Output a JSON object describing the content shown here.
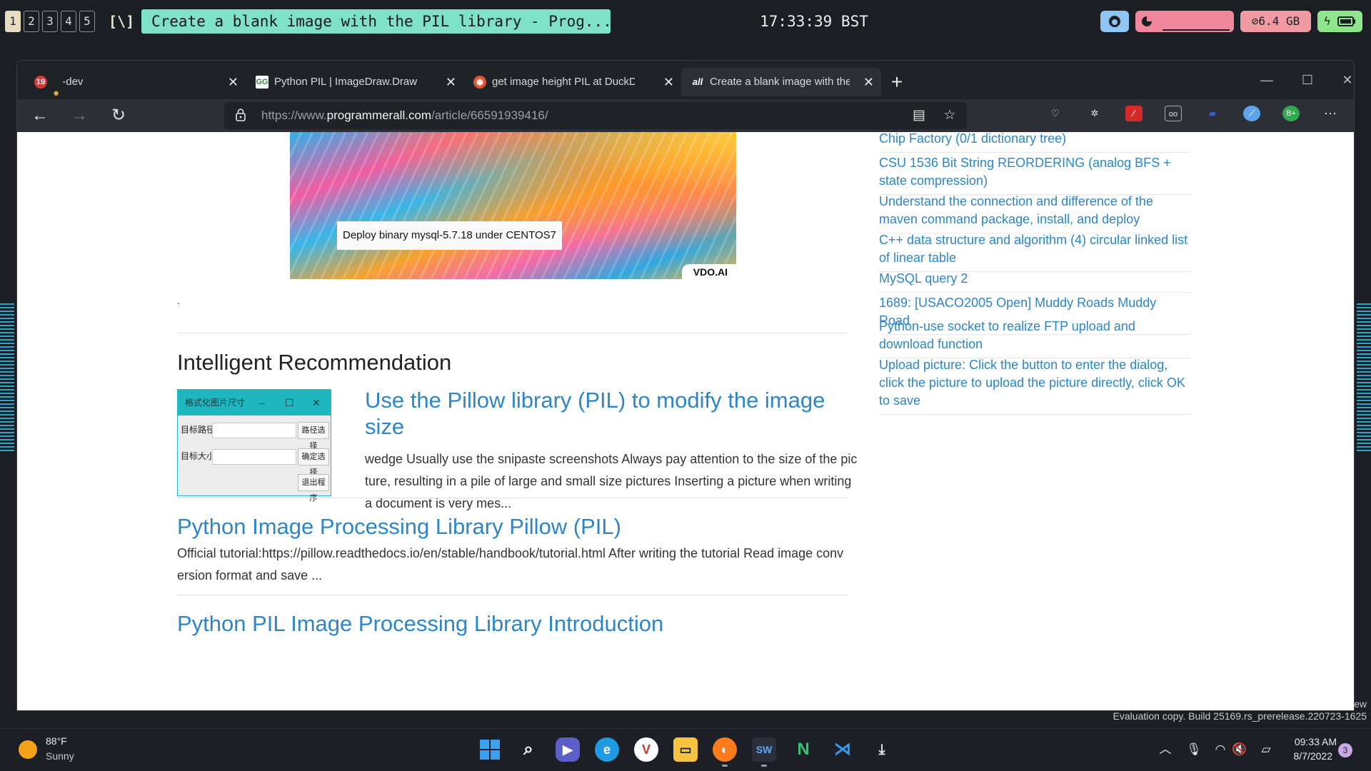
{
  "topbar": {
    "workspaces": [
      "1",
      "2",
      "3",
      "4",
      "5"
    ],
    "layout_symbol": "[\\]",
    "window_title": "Create a blank image with the PIL library - Prog...",
    "clock": "17:33:39 BST",
    "memory": "6.4 GB"
  },
  "browser": {
    "tabs": [
      {
        "label": "-dev",
        "badge": "19",
        "icon": "profile-icon"
      },
      {
        "label": "Python PIL | ImageDraw.Draw.pol",
        "icon": "gfg-icon"
      },
      {
        "label": "get image height PIL at DuckDuc",
        "icon": "duckduckgo-icon"
      },
      {
        "label": "Create a blank image with the PIL",
        "icon": "programmerall-icon",
        "active": true
      }
    ],
    "url_prefix": "https://www.",
    "url_host": "programmerall.com",
    "url_path": "/article/66591939416/"
  },
  "page": {
    "banner": {
      "caption": "Deploy binary mysql-5.7.18 under CENTOS7",
      "brand": "VDO.AI"
    },
    "stray_mark": ".",
    "section_title": "Intelligent Recommendation",
    "thumbnail": {
      "title": "格式化图片尺寸",
      "row1_label": "目标路径:",
      "row1_button": "路径选择",
      "row2_label": "目标大小:",
      "row2_button": "确定选择",
      "exit_button": "退出程序"
    },
    "recommendations": [
      {
        "title": "Use the Pillow library (PIL) to modify the image size",
        "desc": "wedge Usually use the snipaste screenshots Always pay attention to the size of the picture, resulting in a pile of large and small size pictures Inserting a picture when writing a document is very mes..."
      },
      {
        "title": "Python Image Processing Library Pillow (PIL)",
        "desc": "Official tutorial:https://pillow.readthedocs.io/en/stable/handbook/tutorial.html After writing the tutorial Read image conversion format and save  ..."
      },
      {
        "title": "Python PIL Image Processing Library Introduction",
        "desc": ""
      }
    ],
    "sidebar_links": [
      "Chip Factory (0/1 dictionary tree)",
      "CSU 1536 Bit String REORDERING (analog BFS + state compression)",
      "Understand the connection and difference of the maven command package, install, and deploy",
      "C++ data structure and algorithm (4) circular linked list of linear table",
      "MySQL query 2",
      "1689: [USACO2005 Open] Muddy Roads Muddy Road",
      "Python-use socket to realize FTP upload and download function",
      "Upload picture: Click the button to enter the dialog, click the picture to upload the picture directly, click OK to save"
    ]
  },
  "desktop": {
    "eval_line1": "ew",
    "eval_line2": "Evaluation copy. Build 25169.rs_prerelease.220723-1625"
  },
  "taskbar": {
    "temperature": "88°F",
    "condition": "Sunny",
    "time": "09:33 AM",
    "date": "8/7/2022",
    "notifications": "3"
  },
  "colors": {
    "link": "#2c86c9",
    "title_pill": "#7ee2c8",
    "cpu_pill": "#f2889e",
    "mem_pill": "#f29aa4",
    "battery_pill": "#8ee58c"
  }
}
